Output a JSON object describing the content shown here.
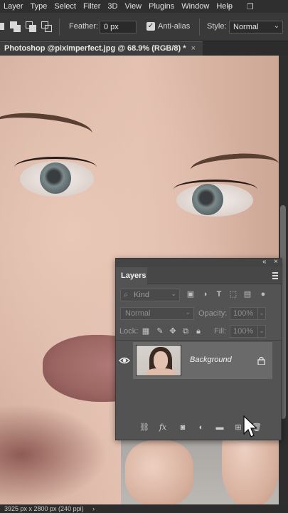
{
  "menu": [
    "Layer",
    "Type",
    "Select",
    "Filter",
    "3D",
    "View",
    "Plugins",
    "Window",
    "Help"
  ],
  "window_controls": {
    "minimize": "–",
    "maximize": "❐"
  },
  "options": {
    "feather_label": "Feather:",
    "feather_value": "0 px",
    "antialias_label": "Anti-alias",
    "antialias_checked": true,
    "style_label": "Style:",
    "style_value": "Normal"
  },
  "document_tab": {
    "title": "Photoshop @piximperfect.jpg @ 68.9% (RGB/8) *",
    "close": "×"
  },
  "status_bar": {
    "text": "3925 px x 2800 px (240 ppi)",
    "arrow": "›"
  },
  "layers_panel": {
    "tab_label": "Layers",
    "collapse": "«",
    "close": "×",
    "filter_kind_placeholder": "Kind",
    "blend_mode": "Normal",
    "opacity_label": "Opacity:",
    "opacity_value": "100%",
    "lock_label": "Lock:",
    "fill_label": "Fill:",
    "fill_value": "100%",
    "layers": [
      {
        "name": "Background",
        "visible": true,
        "locked": true
      }
    ]
  },
  "colors": {
    "menubar_bg": "#2f2f2f",
    "options_bg": "#393939",
    "panel_bg": "#535353",
    "selected_layer_bg": "#6a6a6a"
  },
  "icons": {
    "filter_icons": [
      "pixel-filter-icon",
      "adjustment-filter-icon",
      "type-filter-icon",
      "shape-filter-icon",
      "smart-object-filter-icon",
      "filter-toggle-icon"
    ],
    "lock_icons": [
      "lock-transparent-icon",
      "lock-image-icon",
      "lock-position-icon",
      "lock-artboard-icon",
      "lock-all-icon"
    ],
    "footer_icons": [
      "link-layers-icon",
      "fx-icon",
      "mask-icon",
      "adjustment-layer-icon",
      "new-group-icon",
      "new-layer-icon",
      "delete-layer-icon"
    ]
  }
}
